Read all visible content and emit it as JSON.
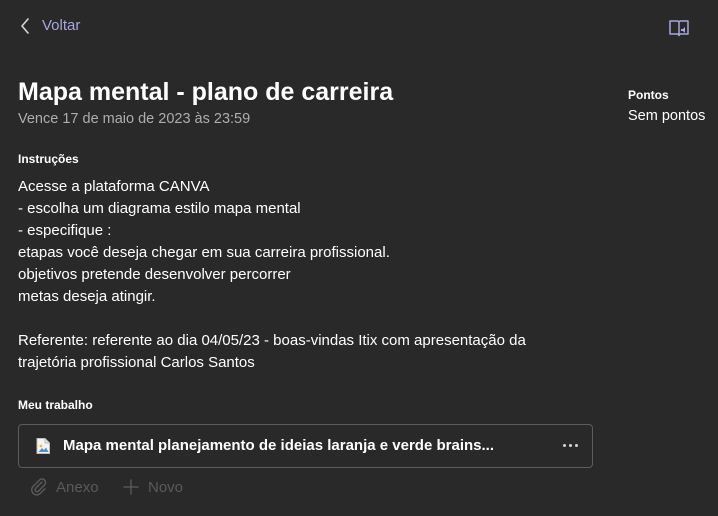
{
  "nav": {
    "back_label": "Voltar",
    "back_icon": "chevron-left-icon",
    "reader_icon": "immersive-reader-icon",
    "accent_color": "#a6a7dc"
  },
  "assignment": {
    "title": "Mapa mental - plano de carreira",
    "due": "Vence 17 de maio de 2023 às 23:59"
  },
  "points": {
    "label": "Pontos",
    "value": "Sem pontos"
  },
  "instructions": {
    "label": "Instruções",
    "lines": [
      "Acesse a plataforma CANVA",
      "- escolha um diagrama estilo mapa mental",
      "- especifique :",
      "etapas você deseja chegar em sua carreira profissional.",
      "objetivos pretende desenvolver percorrer",
      "metas deseja atingir."
    ],
    "referente_lines": [
      "Referente: referente ao dia 04/05/23 - boas-vindas Itix com apresentação da",
      "trajetória profissional Carlos Santos"
    ]
  },
  "my_work": {
    "label": "Meu trabalho",
    "file": {
      "name": "Mapa mental planejamento de ideias laranja e verde brains...",
      "icon": "image-file-icon"
    },
    "actions": {
      "attach_label": "Anexo",
      "attach_icon": "paperclip-icon",
      "new_label": "Novo",
      "new_icon": "plus-icon"
    }
  }
}
